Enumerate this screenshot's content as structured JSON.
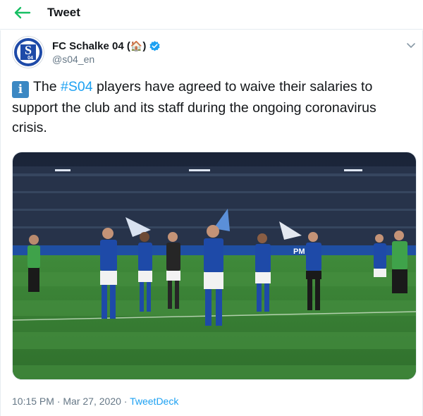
{
  "header": {
    "title": "Tweet",
    "back_icon": "arrow-left-icon",
    "accent": "#17bf63"
  },
  "tweet": {
    "author": {
      "name": "FC Schalke 04 (",
      "emoji": "🏠",
      "name_close": ")",
      "handle": "@s04_en",
      "verified_icon": "verified-badge-icon",
      "avatar_text": "04",
      "avatar_letter": "S"
    },
    "text": {
      "lead_icon": "i",
      "before": "The ",
      "hashtag": "#S04",
      "after": " players have agreed to waive their salaries to support the club and its staff during the ongoing coronavirus crisis."
    },
    "media": {
      "banner": "PM"
    },
    "meta": {
      "time": "10:15 PM",
      "sep1": " · ",
      "date": "Mar 27, 2020",
      "sep2": " · ",
      "source": "TweetDeck"
    },
    "colors": {
      "link": "#1da1f2",
      "verified": "#1da1f2",
      "schalke_blue": "#1e4aa8"
    }
  }
}
